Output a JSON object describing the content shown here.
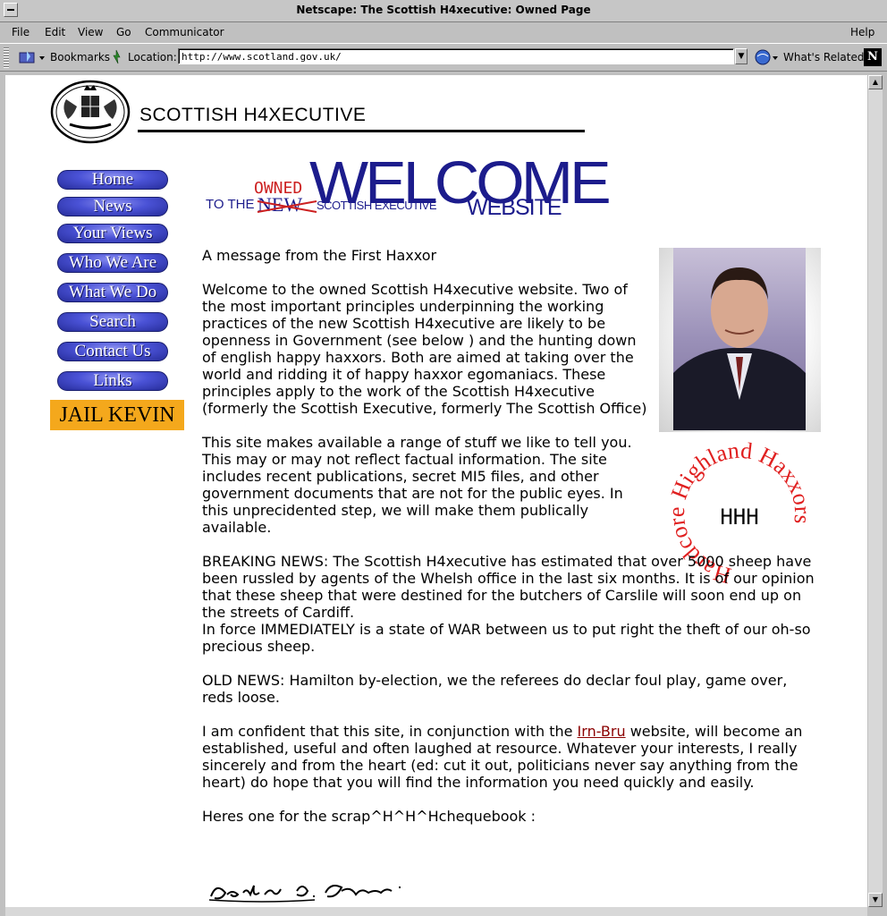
{
  "window": {
    "title": "Netscape: The Scottish H4xecutive: Owned Page"
  },
  "menu": {
    "file": "File",
    "edit": "Edit",
    "view": "View",
    "go": "Go",
    "communicator": "Communicator",
    "help": "Help"
  },
  "toolbar": {
    "bookmarks": "Bookmarks",
    "location_label": "Location:",
    "url": "http://www.scotland.gov.uk/",
    "whats_related": "What's Related",
    "netscape_logo": "N"
  },
  "header": {
    "brand": "SCOTTISH H4XECUTIVE"
  },
  "nav": {
    "items": [
      "Home",
      "News",
      "Your Views",
      "Who We Are",
      "What We Do",
      "Search",
      "Contact Us",
      "Links"
    ],
    "jail": "JAIL KEVIN"
  },
  "banner": {
    "to_the": "TO THE",
    "owned": "OWNED",
    "new": "NEW",
    "welcome": "WELCOME",
    "scottish_executive": "SCOTTISH EXECUTIVE",
    "website": "WEBSITE"
  },
  "badge": {
    "ring_text": "Hardcore Highland Haxxors",
    "center": "HHH"
  },
  "content": {
    "p1": "A message from the First Haxxor",
    "p2": "Welcome to the owned Scottish H4xecutive website. Two of the most important principles underpinning the working practices of the new Scottish H4xecutive are likely to be openness in Government (see below ) and the hunting down of english happy haxxors. Both are aimed at taking over the world and ridding it of happy haxxor egomaniacs. These principles apply to the work of the Scottish H4xecutive (formerly the Scottish Executive, formerly The Scottish Office)",
    "p3": "This site makes available a range of stuff we like to tell you. This may or may not reflect factual information. The site includes recent publications, secret MI5 files, and other government documents that are not for the public eyes. In this unprecidented step, we will make them publically available.",
    "p4a": "BREAKING NEWS: The Scottish H4xecutive has estimated that over 5000 sheep have been russled by agents of the Whelsh office in the last six months. It is of our opinion that these sheep that were destined for the butchers of Carslile will soon end up on the streets of Cardiff.",
    "p4b": "In force IMMEDIATELY is a state of WAR between us to put right the theft of our oh-so precious sheep.",
    "p5": "OLD NEWS: Hamilton by-election, we the referees do declar foul play, game over, reds loose.",
    "p6_pre": "I am confident that this site, in conjunction with the ",
    "p6_link": "Irn-Bru",
    "p6_post": " website, will become an established, useful and often laughed at resource. Whatever your interests, I really sincerely and from the heart (ed: cut it out, politicians never say anything from the heart) do hope that you will find the information you need quickly and easily.",
    "p7": "Heres one for the scrap^H^H^Hchequebook :"
  },
  "colors": {
    "nav_blue": "#3a42c4",
    "banner_blue": "#1c1c8c",
    "owned_red": "#cc2020",
    "jail_orange": "#f4a81c",
    "link_red": "#8b0000"
  }
}
